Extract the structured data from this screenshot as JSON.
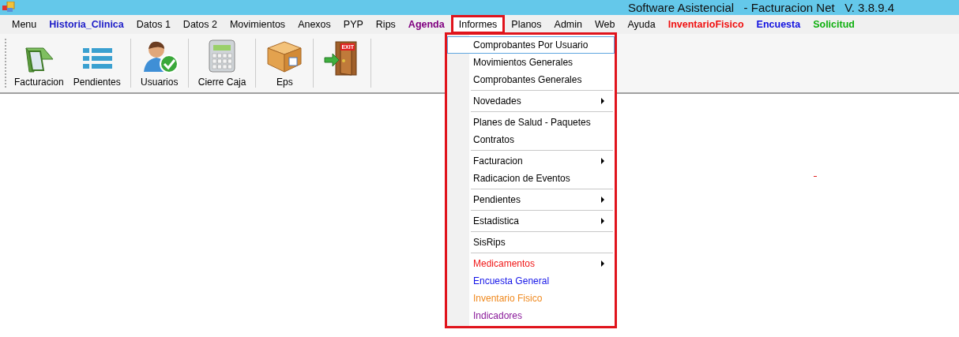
{
  "window": {
    "title": "Software Asistencial   - Facturacion Net   V. 3.8.9.4"
  },
  "menubar": [
    {
      "label": "Menu",
      "selected": false
    },
    {
      "label": "Historia_Clinica",
      "selected": false,
      "color": "#1c1cc8"
    },
    {
      "label": "Datos 1",
      "selected": false
    },
    {
      "label": "Datos 2",
      "selected": false
    },
    {
      "label": "Movimientos",
      "selected": false
    },
    {
      "label": "Anexos",
      "selected": false
    },
    {
      "label": "PYP",
      "selected": false
    },
    {
      "label": "Rips",
      "selected": false
    },
    {
      "label": "Agenda",
      "selected": false,
      "color": "#800080"
    },
    {
      "label": "Informes",
      "selected": true
    },
    {
      "label": "Planos",
      "selected": false
    },
    {
      "label": "Admin",
      "selected": false
    },
    {
      "label": "Web",
      "selected": false
    },
    {
      "label": "Ayuda",
      "selected": false
    },
    {
      "label": "InventarioFisico",
      "selected": false,
      "color": "#f01010"
    },
    {
      "label": "Encuesta",
      "selected": false,
      "color": "#1010e0"
    },
    {
      "label": "Solicitud",
      "selected": false,
      "color": "#10b010"
    }
  ],
  "toolbar": [
    {
      "kind": "invoice",
      "label": "Facturacion"
    },
    {
      "kind": "list",
      "label": "Pendientes"
    },
    {
      "kind": "user",
      "label": "Usuarios"
    },
    {
      "kind": "calculator",
      "label": "Cierre Caja"
    },
    {
      "kind": "box",
      "label": "Eps"
    },
    {
      "kind": "exit",
      "sign": "EXIT"
    }
  ],
  "dropdown": {
    "groups": [
      [
        {
          "label": "Comprobantes Por Usuario",
          "selected": true,
          "submenu": false
        },
        {
          "label": "Movimientos Generales",
          "selected": false,
          "submenu": false
        },
        {
          "label": "Comprobantes Generales",
          "selected": false,
          "submenu": false
        }
      ],
      [
        {
          "label": "Novedades",
          "selected": false,
          "submenu": true
        }
      ],
      [
        {
          "label": "Planes de Salud - Paquetes",
          "selected": false,
          "submenu": false
        },
        {
          "label": "Contratos",
          "selected": false,
          "submenu": false
        }
      ],
      [
        {
          "label": "Facturacion",
          "selected": false,
          "submenu": true
        },
        {
          "label": "Radicacion de Eventos",
          "selected": false,
          "submenu": false
        }
      ],
      [
        {
          "label": "Pendientes",
          "selected": false,
          "submenu": true
        }
      ],
      [
        {
          "label": "Estadistica",
          "selected": false,
          "submenu": true
        }
      ],
      [
        {
          "label": "SisRips",
          "selected": false,
          "submenu": false
        }
      ],
      [
        {
          "label": "Medicamentos",
          "selected": false,
          "submenu": true,
          "color": "#f01818"
        },
        {
          "label": "Encuesta General",
          "selected": false,
          "submenu": false,
          "color": "#1515e8"
        },
        {
          "label": "Inventario Fisico",
          "selected": false,
          "submenu": false,
          "color": "#f08a20"
        },
        {
          "label": "Indicadores",
          "selected": false,
          "submenu": false,
          "color": "#8a1a9a"
        }
      ]
    ]
  }
}
